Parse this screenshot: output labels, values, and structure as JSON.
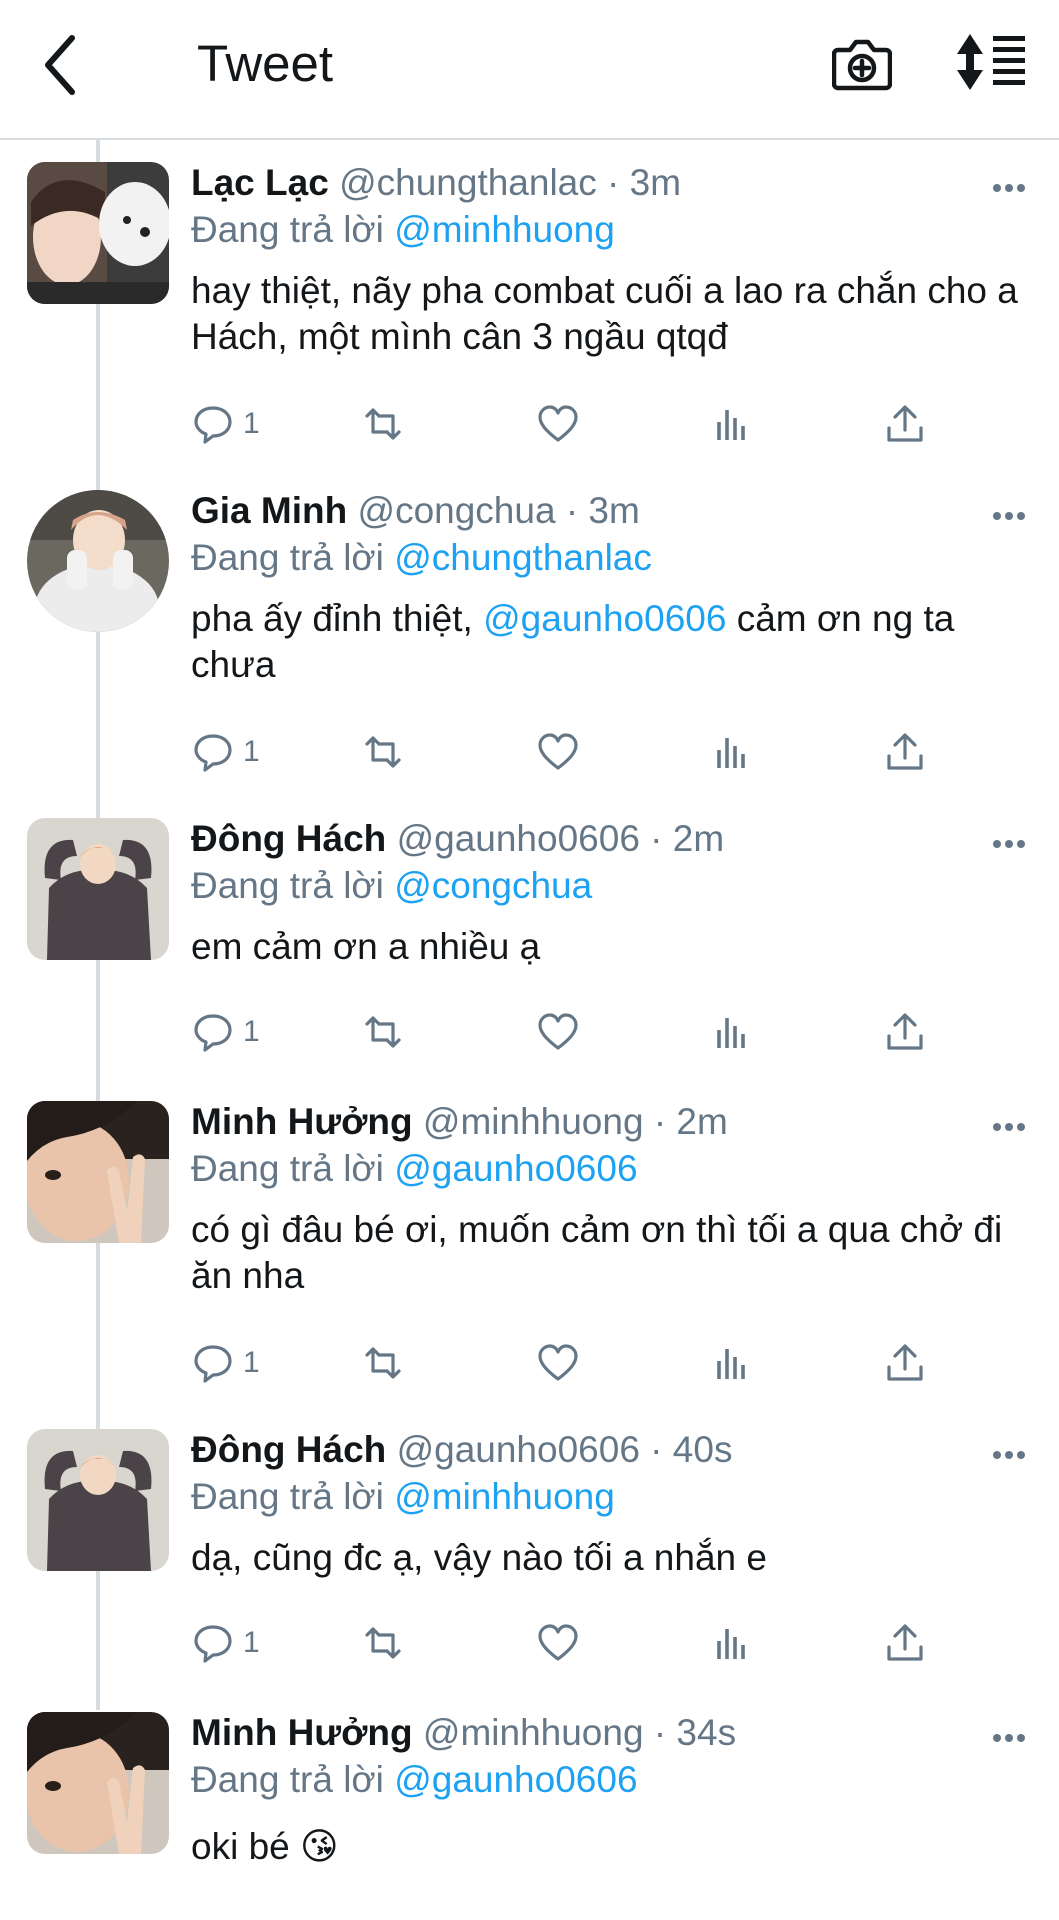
{
  "header": {
    "title": "Tweet"
  },
  "colors": {
    "accent": "#1da1f2",
    "muted": "#657786",
    "text": "#14171a"
  },
  "tweets": [
    {
      "name": "Lạc Lạc",
      "handle": "@chungthanlac",
      "time": " · 3m",
      "reply_prefix": "Đang trả lời ",
      "reply_to": "@minhhuong",
      "text_before": "hay thiệt, nãy pha combat cuối a lao ra chắn cho a Hách, một mình cân 3 ngầu qtqđ",
      "text_mention": "",
      "text_after": "",
      "reply_count": "1",
      "avatar": "avatar-girl-with-dog"
    },
    {
      "name": "Gia Minh",
      "handle": "@congchua",
      "time": " · 3m",
      "reply_prefix": "Đang trả lời ",
      "reply_to": "@chungthanlac",
      "text_before": "pha ấy đỉnh thiệt, ",
      "text_mention": "@gaunho0606",
      "text_after": " cảm ơn ng ta chưa",
      "reply_count": "1",
      "avatar": "avatar-white-hoodie"
    },
    {
      "name": "Đông Hách",
      "handle": "@gaunho0606",
      "time": " · 2m",
      "reply_prefix": "Đang trả lời ",
      "reply_to": "@congchua",
      "text_before": "em cảm ơn a nhiều ạ",
      "text_mention": "",
      "text_after": "",
      "reply_count": "1",
      "avatar": "avatar-heart-pose"
    },
    {
      "name": "Minh Hưởng",
      "handle": "@minhhuong",
      "time": " · 2m",
      "reply_prefix": "Đang trả lời ",
      "reply_to": "@gaunho0606",
      "text_before": "có gì đâu bé ơi, muốn cảm ơn thì tối a qua chở đi ăn nha",
      "text_mention": "",
      "text_after": "",
      "reply_count": "1",
      "avatar": "avatar-peace-sign"
    },
    {
      "name": "Đông Hách",
      "handle": "@gaunho0606",
      "time": " · 40s",
      "reply_prefix": "Đang trả lời ",
      "reply_to": "@minhhuong",
      "text_before": "dạ, cũng đc ạ, vậy nào tối a nhắn e",
      "text_mention": "",
      "text_after": "",
      "reply_count": "1",
      "avatar": "avatar-heart-pose"
    },
    {
      "name": "Minh Hưởng",
      "handle": "@minhhuong",
      "time": " · 34s",
      "reply_prefix": "Đang trả lời ",
      "reply_to": "@gaunho0606",
      "text_before": "oki bé 😘",
      "text_mention": "",
      "text_after": "",
      "reply_count": "",
      "avatar": "avatar-peace-sign"
    }
  ]
}
